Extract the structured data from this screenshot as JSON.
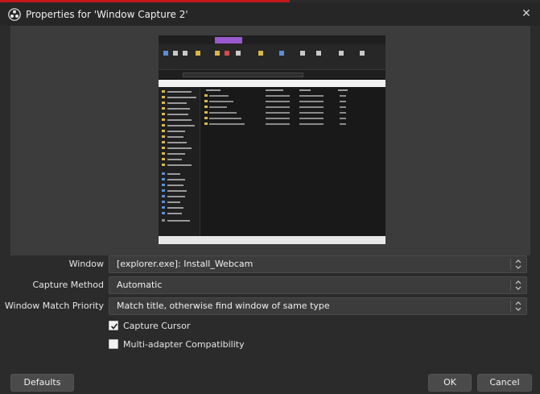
{
  "window": {
    "title": "Properties for 'Window Capture 2'",
    "close_label": "✕"
  },
  "form": {
    "window_label": "Window",
    "window_value": "[explorer.exe]: Install_Webcam",
    "capture_method_label": "Capture Method",
    "capture_method_value": "Automatic",
    "match_priority_label": "Window Match Priority",
    "match_priority_value": "Match title, otherwise find window of same type"
  },
  "options": {
    "capture_cursor_label": "Capture Cursor",
    "capture_cursor_checked": true,
    "multi_adapter_label": "Multi-adapter Compatibility",
    "multi_adapter_checked": false
  },
  "buttons": {
    "defaults_label": "Defaults",
    "ok_label": "OK",
    "cancel_label": "Cancel"
  },
  "icons": {
    "app": "obs-logo-icon",
    "close": "close-icon",
    "combo_arrows": "updown-chevron-icon",
    "check": "checkmark-icon"
  },
  "colors": {
    "accent": "#c21a1a",
    "background": "#2b2b2b",
    "preview_bg": "#3c3c3c"
  }
}
